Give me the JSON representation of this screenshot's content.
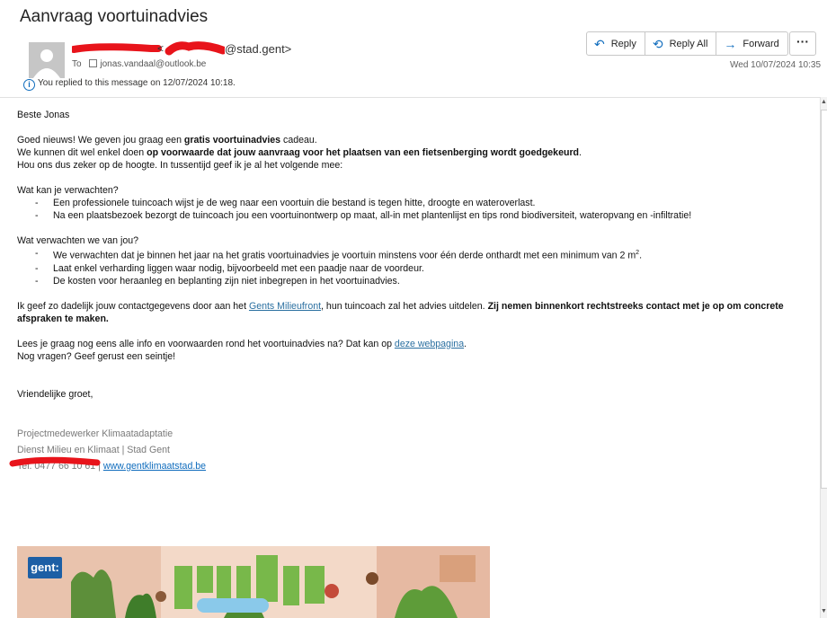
{
  "subject": "Aanvraag voortuinadvies",
  "sender": {
    "email_suffix": "@stad.gent>"
  },
  "to": {
    "label": "To",
    "address": "jonas.vandaal@outlook.be"
  },
  "replied_notice": "You replied to this message on 12/07/2024 10:18.",
  "actions": {
    "reply": "Reply",
    "reply_all": "Reply All",
    "forward": "Forward",
    "more": "···"
  },
  "date": "Wed 10/07/2024 10:35",
  "body": {
    "greeting": "Beste Jonas",
    "p1_a": "Goed nieuws! We geven jou graag een ",
    "p1_b": "gratis voortuinadvies",
    "p1_c": " cadeau.",
    "p2_a": "We kunnen dit wel enkel doen ",
    "p2_b": "op voorwaarde dat jouw aanvraag voor het plaatsen van een fietsenberging wordt goedgekeurd",
    "p2_c": ".",
    "p3": "Hou ons dus zeker op de hoogte. In tussentijd geef ik je al het volgende mee:",
    "h1": "Wat kan je verwachten?",
    "list1": [
      "Een professionele tuincoach wijst je de weg naar een voortuin die bestand is tegen hitte, droogte en wateroverlast.",
      "Na een plaatsbezoek bezorgt de tuincoach jou een voortuinontwerp op maat, all-in met plantenlijst en tips rond biodiversiteit, wateropvang en -infiltratie!"
    ],
    "h2": "Wat verwachten we van jou?",
    "list2_0": "We verwachten dat je binnen het jaar na het gratis voortuinadvies je voortuin minstens voor één derde onthardt met een minimum van 2 m",
    "list2_0_sup": "2",
    "list2_0_end": ".",
    "list2": [
      "Laat enkel verharding liggen waar nodig, bijvoorbeeld met een paadje naar de voordeur.",
      "De kosten voor heraanleg en beplanting zijn niet inbegrepen in het voortuinadvies."
    ],
    "p4_a": "Ik geef zo dadelijk jouw contactgegevens door aan het ",
    "p4_link": "Gents Milieufront",
    "p4_b": ", hun tuincoach zal het advies uitdelen. ",
    "p4_bold": "Zij nemen binnenkort rechtstreeks contact met je op om concrete afspraken te maken.",
    "p5_a": "Lees je graag nog eens alle info en voorwaarden rond het voortuinadvies na? Dat kan op ",
    "p5_link": "deze webpagina",
    "p5_b": ".",
    "p6": "Nog vragen? Geef gerust een seintje!",
    "closing": "Vriendelijke groet,"
  },
  "signature": {
    "role": "Projectmedewerker Klimaatadaptatie",
    "dept": "Dienst Milieu en Klimaat | Stad Gent",
    "tel": "Tel. 0477 66 10 61 | ",
    "link": "www.gentklimaatstad.be"
  },
  "banner": {
    "logo": "gent:"
  },
  "colors": {
    "accent": "#0f6cbd",
    "redaction": "#e8141b",
    "link": "#2a6fa0"
  }
}
